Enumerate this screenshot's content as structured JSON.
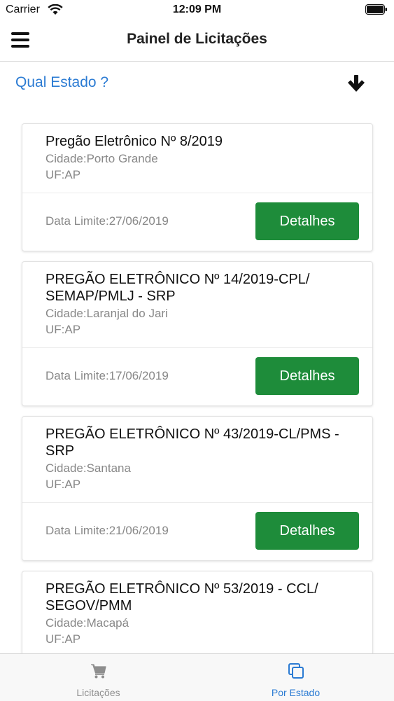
{
  "status_bar": {
    "carrier": "Carrier",
    "time": "12:09 PM"
  },
  "header": {
    "title": "Painel de Licitações"
  },
  "state_picker": {
    "label": "Qual Estado ?"
  },
  "cards": [
    {
      "title": "Pregão Eletrônico Nº 8/2019",
      "city": "Cidade:Porto Grande",
      "uf": "UF:AP",
      "deadline": "Data Limite:27/06/2019",
      "button": "Detalhes"
    },
    {
      "title": "PREGÃO ELETRÔNICO  Nº 14/2019-CPL/ SEMAP/PMLJ - SRP",
      "city": "Cidade:Laranjal do Jari",
      "uf": "UF:AP",
      "deadline": "Data Limite:17/06/2019",
      "button": "Detalhes"
    },
    {
      "title": "PREGÃO ELETRÔNICO Nº 43/2019-CL/PMS - SRP",
      "city": "Cidade:Santana",
      "uf": "UF:AP",
      "deadline": "Data Limite:21/06/2019",
      "button": "Detalhes"
    },
    {
      "title": "PREGÃO ELETRÔNICO Nº 53/2019 - CCL/ SEGOV/PMM",
      "city": "Cidade:Macapá",
      "uf": "UF:AP",
      "deadline": "",
      "button": ""
    }
  ],
  "tab_bar": {
    "tabs": [
      {
        "label": "Licitações",
        "icon": "cart-icon",
        "active": false
      },
      {
        "label": "Por Estado",
        "icon": "copy-icon",
        "active": true
      }
    ]
  },
  "colors": {
    "accent": "#2b7bd3",
    "button_green": "#1e8c3a",
    "tab_inactive": "#8e8e8e",
    "tab_active": "#2b7bd3"
  }
}
